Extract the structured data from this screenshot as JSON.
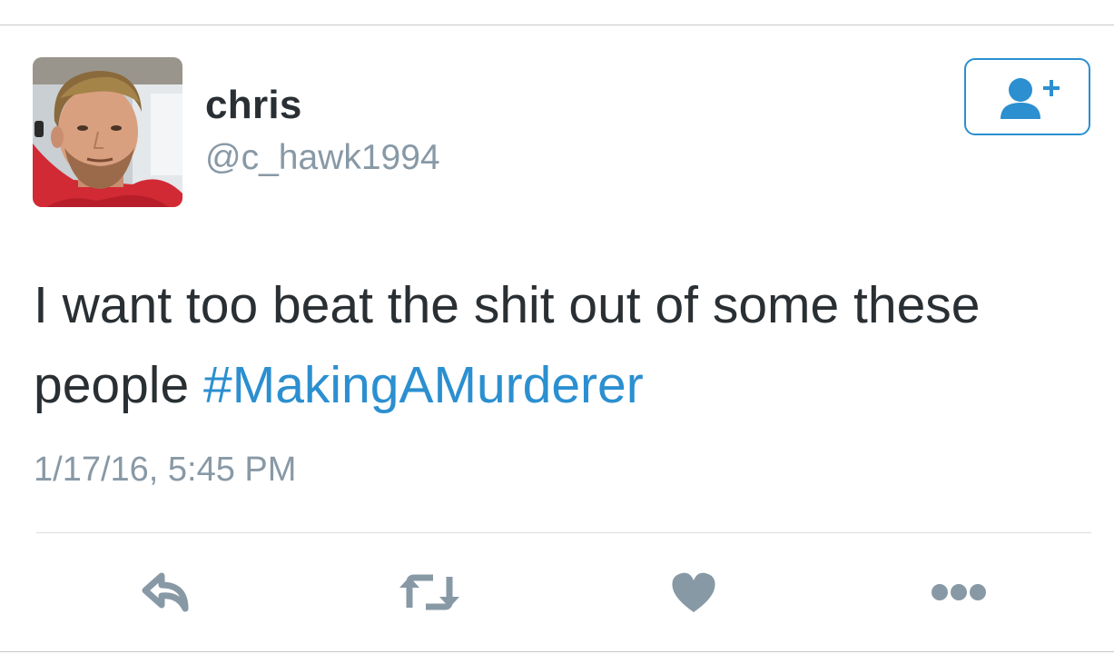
{
  "user": {
    "display_name": "chris",
    "handle": "@c_hawk1994",
    "avatar_icon": "profile-photo"
  },
  "follow_button": {
    "icon": "add-user-icon",
    "color": "#2b8fd0"
  },
  "tweet": {
    "text": "I want too beat the shit out of some these people ",
    "hashtag": "#MakingAMurderer",
    "timestamp": "1/17/16, 5:45 PM"
  },
  "actions": [
    {
      "name": "reply",
      "icon": "reply-icon"
    },
    {
      "name": "retweet",
      "icon": "retweet-icon"
    },
    {
      "name": "like",
      "icon": "heart-icon"
    },
    {
      "name": "more",
      "icon": "more-icon"
    }
  ],
  "colors": {
    "text": "#292f33",
    "secondary": "#8899a6",
    "link": "#2b8fd0",
    "icon": "#8899a6"
  }
}
